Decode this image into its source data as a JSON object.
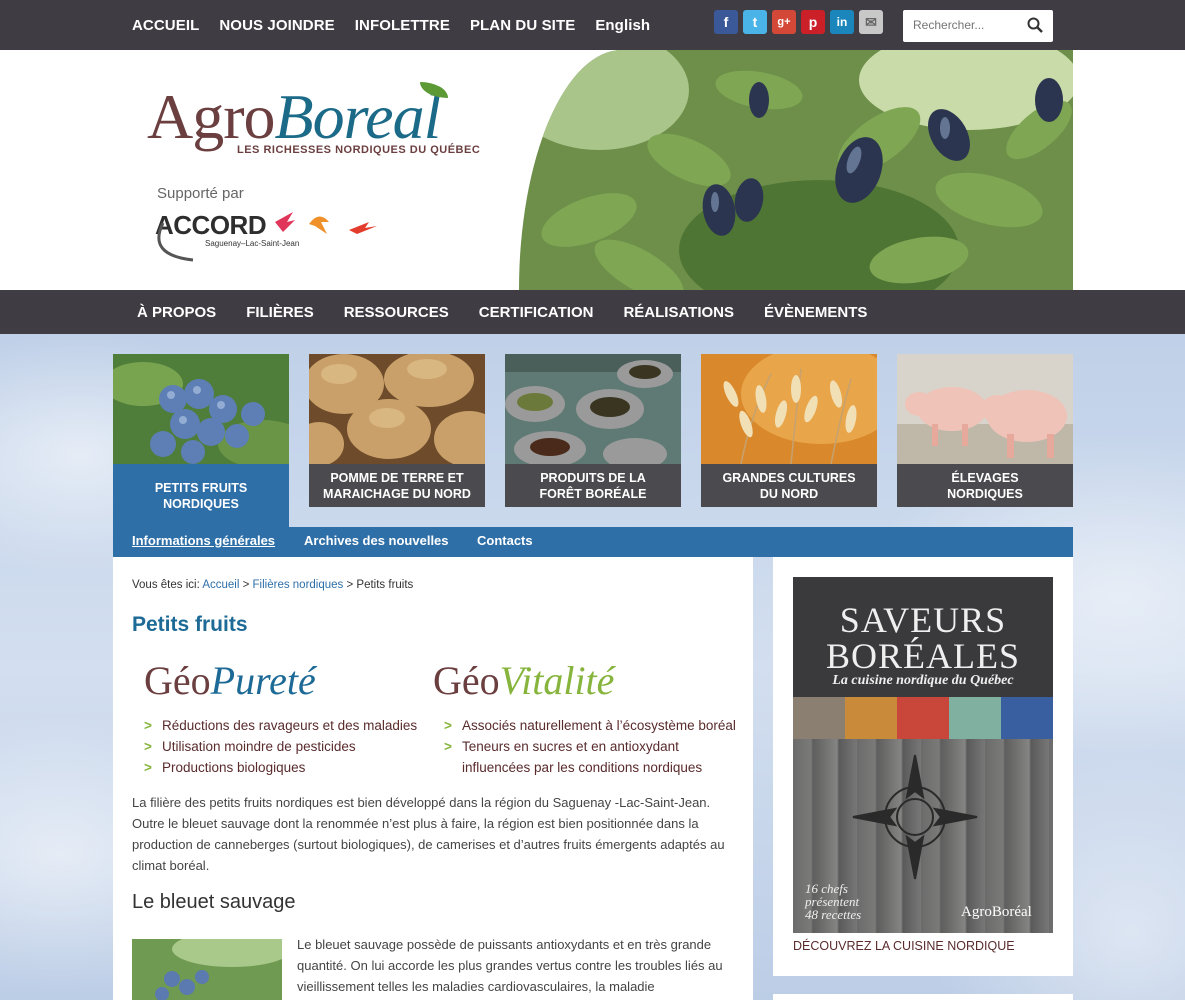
{
  "topnav": {
    "items": [
      "ACCUEIL",
      "NOUS JOINDRE",
      "INFOLETTRE",
      "PLAN DU SITE",
      "English"
    ],
    "social": [
      "facebook-icon",
      "twitter-icon",
      "google-plus-icon",
      "pinterest-icon",
      "linkedin-icon",
      "email-icon"
    ],
    "search_placeholder": "Rechercher..."
  },
  "header": {
    "logo_part1": "Agro",
    "logo_part2": "Boreal",
    "tagline": "LES RICHESSES NORDIQUES DU QUÉBEC",
    "supported_by": "Supporté par",
    "partner": "ACCORD",
    "partner_sub": "Saguenay–Lac-Saint-Jean"
  },
  "mainnav": {
    "items": [
      "À PROPOS",
      "FILIÈRES",
      "RESSOURCES",
      "CERTIFICATION",
      "RÉALISATIONS",
      "ÉVÈNEMENTS"
    ]
  },
  "tiles": [
    {
      "line1": "PETITS FRUITS",
      "line2": "NORDIQUES"
    },
    {
      "line1": "POMME DE TERRE ET",
      "line2": "MARAICHAGE DU NORD"
    },
    {
      "line1": "PRODUITS DE LA",
      "line2": "FORÊT BORÉALE"
    },
    {
      "line1": "GRANDES CULTURES",
      "line2": "DU NORD"
    },
    {
      "line1": "ÉLEVAGES",
      "line2": "NORDIQUES"
    }
  ],
  "subnav": {
    "items": [
      "Informations générales",
      "Archives des nouvelles",
      "Contacts"
    ]
  },
  "content": {
    "crumb_prefix": "Vous êtes ici:",
    "crumb_home": "Accueil",
    "crumb_sep": ">",
    "crumb_section": "Filières nordiques",
    "crumb_current": "Petits fruits",
    "title": "Petits fruits",
    "geo1_a": "Géo",
    "geo1_b": "Pureté",
    "geo2_a": "Géo",
    "geo2_b": "Vitalité",
    "purete_items": [
      "Réductions des ravageurs et des maladies",
      "Utilisation moindre de pesticides",
      "Productions biologiques"
    ],
    "vitalite_items": [
      "Associés naturellement à l’écosystème boréal",
      "Teneurs en sucres et en antioxydant",
      "influencées par les conditions nordiques"
    ],
    "paragraph": "La filière des petits fruits nordiques est bien développé dans la région du Saguenay -Lac-Saint-Jean. Outre le bleuet sauvage dont la renommée n’est plus à faire, la région est bien positionnée dans la production de canneberges (surtout biologiques), de camerises et d’autres fruits émergents adaptés au climat boréal.",
    "subtitle": "Le bleuet sauvage",
    "paragraph2": "Le bleuet sauvage possède de puissants antioxydants et en très grande quantité. On lui accorde les plus grandes vertus contre les troubles liés au vieillissement telles les maladies cardiovasculaires, la maladie"
  },
  "sidebar": {
    "book_title1": "SAVEURS",
    "book_title2": "BORÉALES",
    "book_subtitle": "La cuisine nordique du Québec",
    "book_chefs1": "16 chefs",
    "book_chefs2": "présentent",
    "book_chefs3": "48 recettes",
    "book_logo": "AgroBoréal",
    "link": "DÉCOUVREZ LA CUISINE NORDIQUE"
  },
  "colors": {
    "dark_bar": "#3f3c43",
    "accent_blue": "#2e6fa8",
    "brand_brown": "#6b3f40",
    "brand_teal": "#1a6a88",
    "brand_green": "#86b43c"
  }
}
